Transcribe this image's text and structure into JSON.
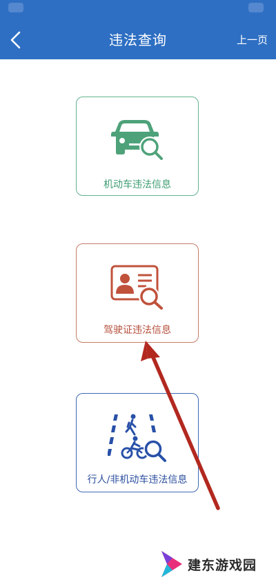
{
  "header": {
    "title": "违法查询",
    "prev_label": "上一页"
  },
  "options": [
    {
      "label": "机动车违法信息",
      "icon": "car-search-icon",
      "color": "#3f9d73"
    },
    {
      "label": "驾驶证违法信息",
      "icon": "license-search-icon",
      "color": "#b5503c"
    },
    {
      "label": "行人/非机动车违法信息",
      "icon": "pedestrian-bicycle-search-icon",
      "color": "#2a4e9e"
    }
  ],
  "watermark": {
    "text": "建东游戏园"
  },
  "colors": {
    "navbar": "#2e6fc3",
    "arrow": "#b2281f"
  }
}
